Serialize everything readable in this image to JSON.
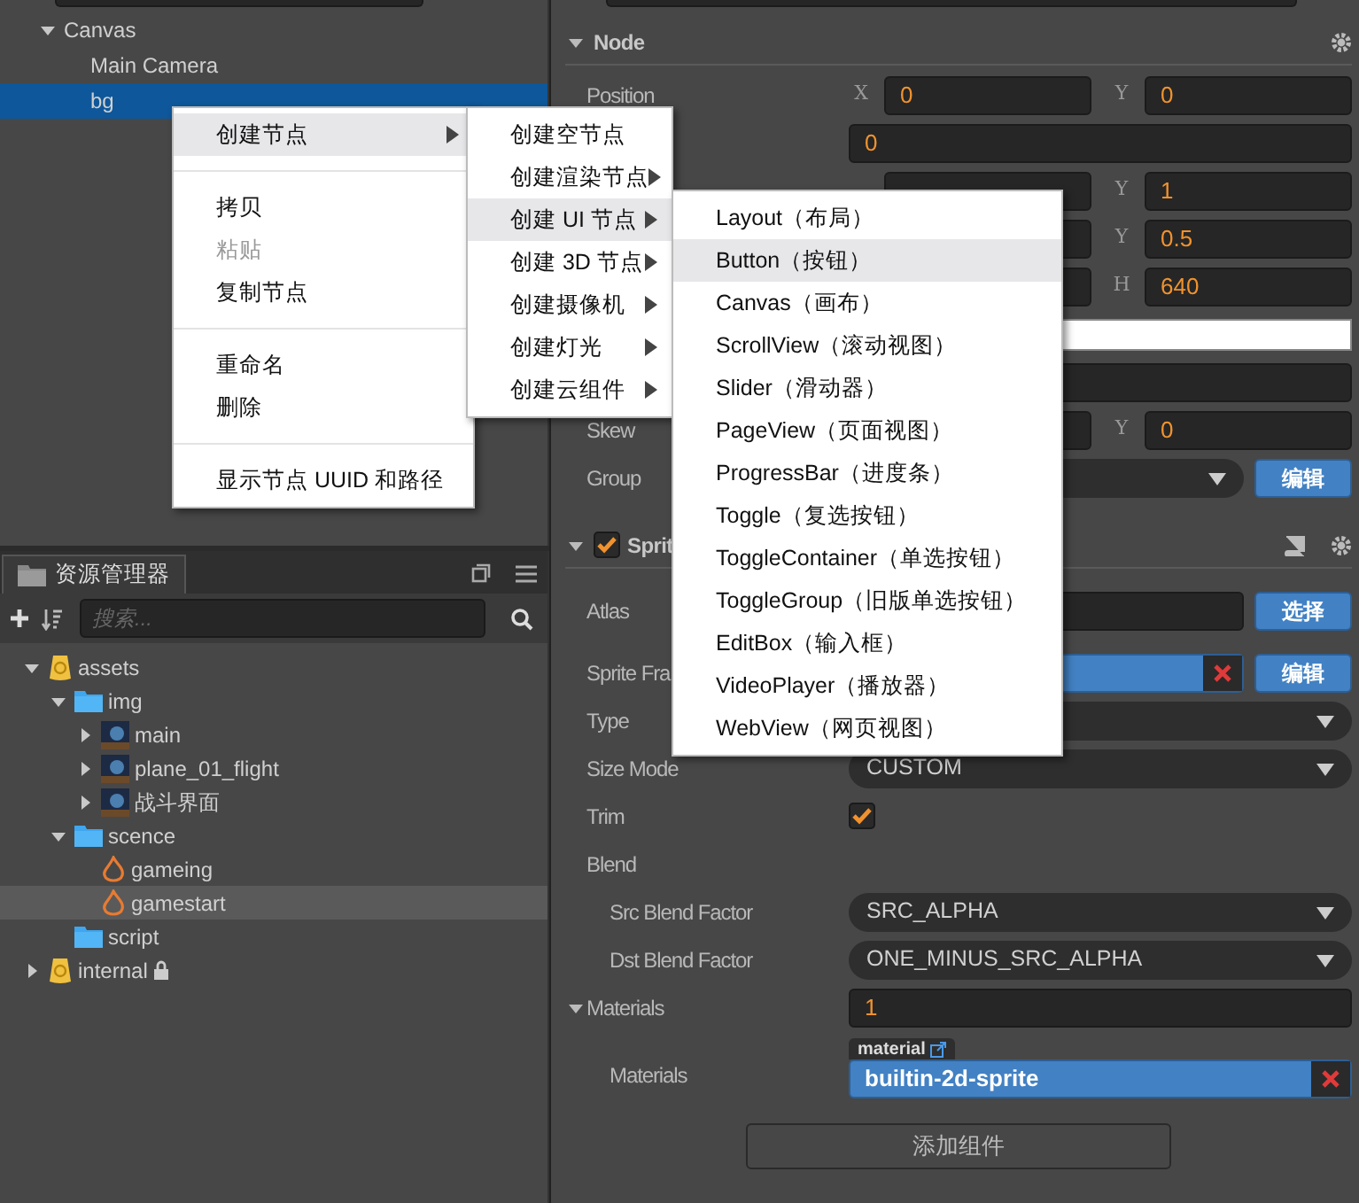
{
  "hierarchy": {
    "items": [
      {
        "label": "Canvas",
        "expanded": true,
        "selected": false,
        "children": [
          {
            "label": "Main Camera",
            "selected": false
          },
          {
            "label": "bg",
            "selected": true
          }
        ]
      }
    ]
  },
  "context_menu": {
    "items": [
      {
        "kind": "item",
        "label": "创建节点",
        "submenu": true,
        "highlighted": true,
        "disabled": false
      },
      {
        "kind": "separator"
      },
      {
        "kind": "item",
        "label": "拷贝",
        "submenu": false,
        "highlighted": false,
        "disabled": false
      },
      {
        "kind": "item",
        "label": "粘贴",
        "submenu": false,
        "highlighted": false,
        "disabled": true
      },
      {
        "kind": "item",
        "label": "复制节点",
        "submenu": false,
        "highlighted": false,
        "disabled": false
      },
      {
        "kind": "separator"
      },
      {
        "kind": "item",
        "label": "重命名",
        "submenu": false,
        "highlighted": false,
        "disabled": false
      },
      {
        "kind": "item",
        "label": "删除",
        "submenu": false,
        "highlighted": false,
        "disabled": false
      },
      {
        "kind": "separator"
      },
      {
        "kind": "item",
        "label": "显示节点 UUID 和路径",
        "submenu": false,
        "highlighted": false,
        "disabled": false
      }
    ]
  },
  "create_menu": {
    "items": [
      {
        "kind": "item",
        "label": "创建空节点",
        "submenu": false,
        "highlighted": false,
        "disabled": false
      },
      {
        "kind": "item",
        "label": "创建渲染节点",
        "submenu": true,
        "highlighted": false,
        "disabled": false
      },
      {
        "kind": "item",
        "label": "创建 UI 节点",
        "submenu": true,
        "highlighted": true,
        "disabled": false
      },
      {
        "kind": "item",
        "label": "创建 3D 节点",
        "submenu": true,
        "highlighted": false,
        "disabled": false
      },
      {
        "kind": "item",
        "label": "创建摄像机",
        "submenu": true,
        "highlighted": false,
        "disabled": false
      },
      {
        "kind": "item",
        "label": "创建灯光",
        "submenu": true,
        "highlighted": false,
        "disabled": false
      },
      {
        "kind": "item",
        "label": "创建云组件",
        "submenu": true,
        "highlighted": false,
        "disabled": false
      }
    ]
  },
  "ui_menu": {
    "items": [
      {
        "kind": "item",
        "label": "Layout（布局）",
        "submenu": false,
        "highlighted": false,
        "disabled": false
      },
      {
        "kind": "item",
        "label": "Button（按钮）",
        "submenu": false,
        "highlighted": true,
        "disabled": false
      },
      {
        "kind": "item",
        "label": "Canvas（画布）",
        "submenu": false,
        "highlighted": false,
        "disabled": false
      },
      {
        "kind": "item",
        "label": "ScrollView（滚动视图）",
        "submenu": false,
        "highlighted": false,
        "disabled": false
      },
      {
        "kind": "item",
        "label": "Slider（滑动器）",
        "submenu": false,
        "highlighted": false,
        "disabled": false
      },
      {
        "kind": "item",
        "label": "PageView（页面视图）",
        "submenu": false,
        "highlighted": false,
        "disabled": false
      },
      {
        "kind": "item",
        "label": "ProgressBar（进度条）",
        "submenu": false,
        "highlighted": false,
        "disabled": false
      },
      {
        "kind": "item",
        "label": "Toggle（复选按钮）",
        "submenu": false,
        "highlighted": false,
        "disabled": false
      },
      {
        "kind": "item",
        "label": "ToggleContainer（单选按钮）",
        "submenu": false,
        "highlighted": false,
        "disabled": false
      },
      {
        "kind": "item",
        "label": "ToggleGroup（旧版单选按钮）",
        "submenu": false,
        "highlighted": false,
        "disabled": false
      },
      {
        "kind": "item",
        "label": "EditBox（输入框）",
        "submenu": false,
        "highlighted": false,
        "disabled": false
      },
      {
        "kind": "item",
        "label": "VideoPlayer（播放器）",
        "submenu": false,
        "highlighted": false,
        "disabled": false
      },
      {
        "kind": "item",
        "label": "WebView（网页视图）",
        "submenu": false,
        "highlighted": false,
        "disabled": false
      }
    ]
  },
  "assets": {
    "tab": "资源管理器",
    "search_placeholder": "搜索...",
    "items": [
      {
        "label": "assets",
        "kind": "database",
        "expanded": true,
        "selected": false,
        "children": [
          {
            "label": "img",
            "kind": "folder",
            "expanded": true,
            "selected": false,
            "children": [
              {
                "label": "main",
                "kind": "image",
                "expanded": false,
                "selected": false
              },
              {
                "label": "plane_01_flight",
                "kind": "image",
                "expanded": false,
                "selected": false
              },
              {
                "label": "战斗界面",
                "kind": "image",
                "expanded": false,
                "selected": false
              }
            ]
          },
          {
            "label": "scence",
            "kind": "folder",
            "expanded": true,
            "selected": false,
            "children": [
              {
                "label": "gameing",
                "kind": "scene",
                "selected": false
              },
              {
                "label": "gamestart",
                "kind": "scene",
                "selected": true
              }
            ]
          },
          {
            "label": "script",
            "kind": "folder",
            "selected": false
          }
        ]
      },
      {
        "label": "internal",
        "kind": "database",
        "expanded": false,
        "selected": false,
        "locked": true
      }
    ]
  },
  "inspector": {
    "node": {
      "title": "Node",
      "expanded": true,
      "rows": [
        {
          "kind": "vec2",
          "label": "Position",
          "x": {
            "label": "X",
            "value": "0"
          },
          "y": {
            "label": "Y",
            "value": "0"
          }
        },
        {
          "kind": "number",
          "value": "0"
        },
        {
          "kind": "vec2",
          "x": {},
          "y": {
            "label": "Y",
            "value": "1"
          }
        },
        {
          "kind": "vec2",
          "x": {},
          "y": {
            "label": "Y",
            "value": "0.5"
          }
        },
        {
          "kind": "vec2",
          "x": {},
          "y": {
            "label": "H",
            "value": "640"
          }
        },
        {
          "kind": "color"
        },
        {
          "kind": "number"
        },
        {
          "kind": "vec2",
          "label": "Skew",
          "x": {},
          "y": {
            "label": "Y",
            "value": "0"
          }
        },
        {
          "kind": "select",
          "label": "Group",
          "button": "编辑"
        }
      ]
    },
    "sprite": {
      "title": "Sprit",
      "expanded": true,
      "enabled": true,
      "rows": [
        {
          "kind": "asset",
          "label": "Atlas",
          "set": false,
          "button": "选择"
        },
        {
          "kind": "asset",
          "label": "Sprite Fra",
          "set": true,
          "button": "编辑"
        },
        {
          "kind": "select",
          "label": "Type"
        },
        {
          "kind": "select",
          "label": "Size Mode",
          "value": "CUSTOM"
        },
        {
          "kind": "checkbox",
          "label": "Trim",
          "checked": true
        },
        {
          "kind": "group",
          "label": "Blend",
          "children": [
            {
              "kind": "select",
              "label": "Src Blend Factor",
              "value": "SRC_ALPHA"
            },
            {
              "kind": "select",
              "label": "Dst Blend Factor",
              "value": "ONE_MINUS_SRC_ALPHA"
            }
          ]
        },
        {
          "kind": "array",
          "label": "Materials",
          "expanded": true,
          "value": "1",
          "children": [
            {
              "kind": "material",
              "label": "Materials",
              "tag": "material",
              "value": "builtin-2d-sprite"
            }
          ]
        }
      ]
    },
    "add_button": "添加组件"
  }
}
